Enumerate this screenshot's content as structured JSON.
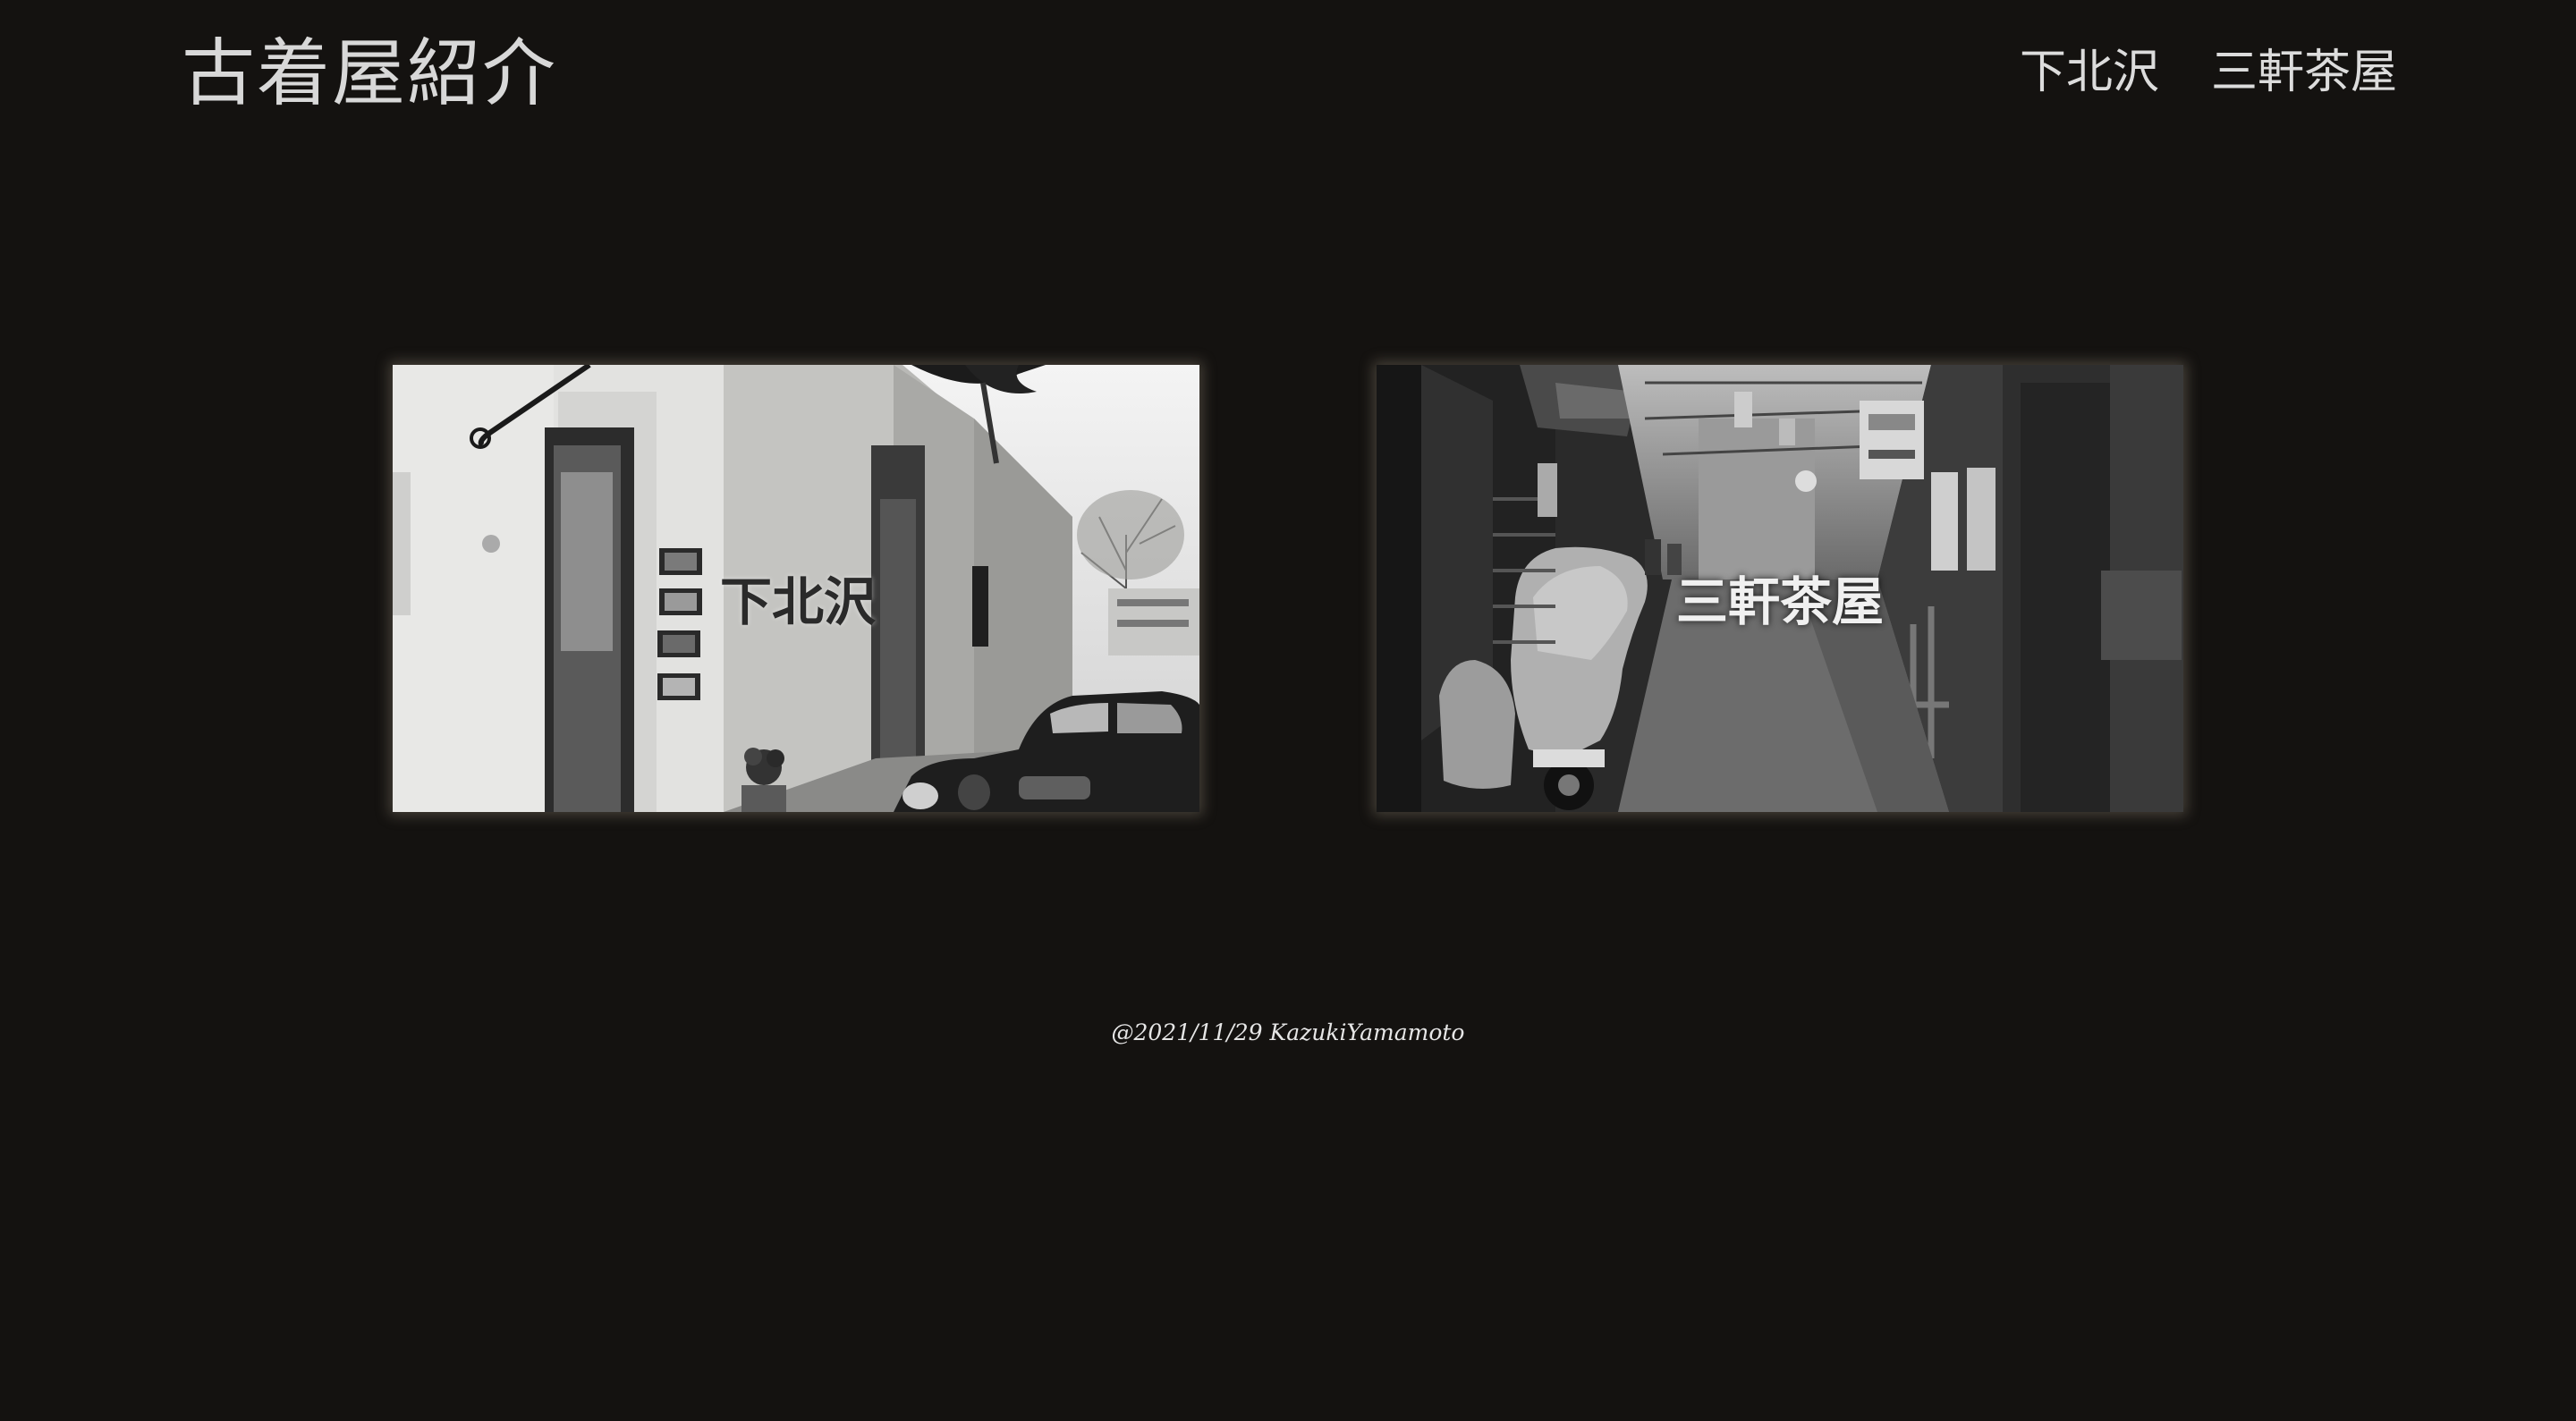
{
  "header": {
    "title": "古着屋紹介",
    "nav": [
      {
        "label": "下北沢"
      },
      {
        "label": "三軒茶屋"
      }
    ]
  },
  "cards": [
    {
      "label": "下北沢",
      "photo": "white-storefront-street-with-vintage-car"
    },
    {
      "label": "三軒茶屋",
      "photo": "narrow-alley-with-covered-scooter"
    }
  ],
  "footer": {
    "text": "@2021/11/29 KazukiYamamoto"
  },
  "colors": {
    "background": "#141210",
    "text": "#d8d8d8"
  }
}
